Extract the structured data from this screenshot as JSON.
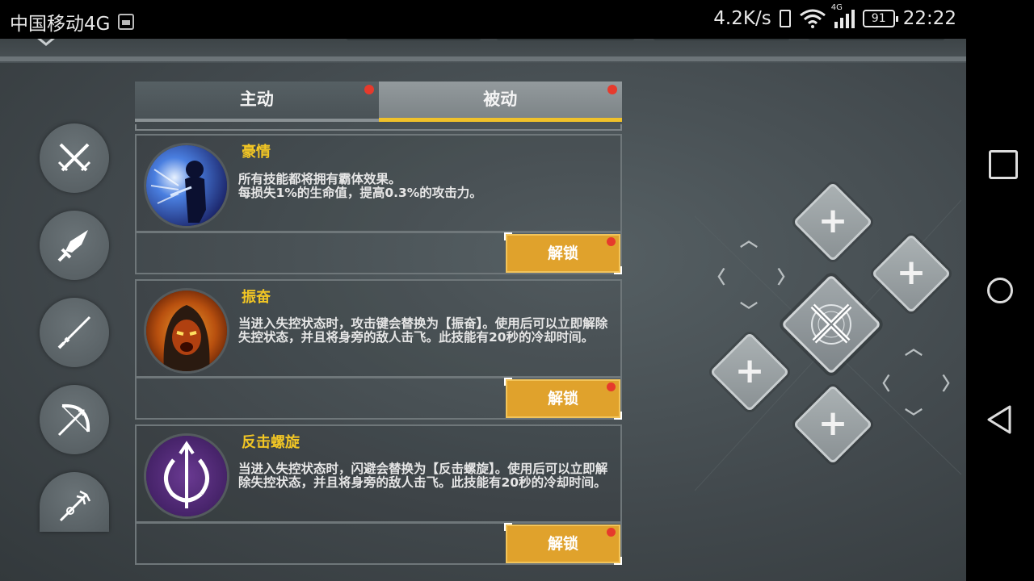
{
  "status_bar": {
    "carrier": "中国移动4G",
    "speed": "4.2K/s",
    "network_label": "4G",
    "battery": "91",
    "time": "22:22"
  },
  "tabs": [
    {
      "label": "主动",
      "has_badge": true
    },
    {
      "label": "被动",
      "has_badge": true,
      "selected": true
    }
  ],
  "skills": [
    {
      "name": "豪情",
      "description": "所有技能都将拥有霸体效果。\n每损失1%的生命值，提高0.3%的攻击力。",
      "button_label": "解锁",
      "icon": "silhouette-burst-icon"
    },
    {
      "name": "振奋",
      "description": "当进入失控状态时，攻击键会替换为【振奋】。使用后可以立即解除失控状态，并且将身旁的敌人击飞。此技能有20秒的冷却时间。",
      "button_label": "解锁",
      "icon": "hooded-warrior-icon"
    },
    {
      "name": "反击螺旋",
      "description": "当进入失控状态时，闪避会替换为【反击螺旋】。使用后可以立即解除失控状态，并且将身旁的敌人击飞。此技能有20秒的冷却时间。",
      "button_label": "解锁",
      "icon": "spiral-arrow-icon"
    }
  ],
  "categories": [
    "crossed-swords-icon",
    "greatsword-icon",
    "katana-icon",
    "bow-icon",
    "trident-icon"
  ],
  "slot_plus": "+",
  "colors": {
    "accent_gold": "#f2c624",
    "unlock_button": "#e0a22c",
    "badge_red": "#e63a2c",
    "tab_underline": "#f0c12a"
  }
}
